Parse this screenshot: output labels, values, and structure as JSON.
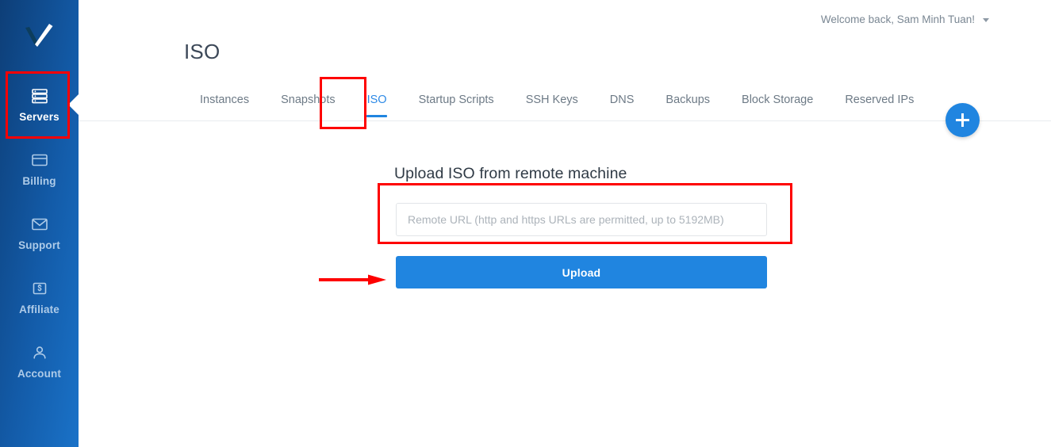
{
  "brand": {
    "name": "Vultr",
    "logo_icon": "vultr-checkmark-logo",
    "accent_color": "#2085e0",
    "sidebar_gradient_from": "#0d3e77",
    "sidebar_gradient_to": "#1a72c8"
  },
  "sidebar": {
    "items": [
      {
        "label": "Servers",
        "icon": "servers-stack-icon",
        "active": true
      },
      {
        "label": "Billing",
        "icon": "credit-card-icon",
        "active": false
      },
      {
        "label": "Support",
        "icon": "envelope-icon",
        "active": false
      },
      {
        "label": "Affiliate",
        "icon": "dollar-box-icon",
        "active": false
      },
      {
        "label": "Account",
        "icon": "user-person-icon",
        "active": false
      }
    ]
  },
  "header": {
    "welcome_text": "Welcome back, Sam Minh Tuan!",
    "caret_icon": "chevron-down-icon"
  },
  "page": {
    "title": "ISO"
  },
  "tabs": [
    {
      "label": "Instances",
      "active": false
    },
    {
      "label": "Snapshots",
      "active": false
    },
    {
      "label": "ISO",
      "active": true
    },
    {
      "label": "Startup Scripts",
      "active": false
    },
    {
      "label": "SSH Keys",
      "active": false
    },
    {
      "label": "DNS",
      "active": false
    },
    {
      "label": "Backups",
      "active": false
    },
    {
      "label": "Block Storage",
      "active": false
    },
    {
      "label": "Reserved IPs",
      "active": false
    }
  ],
  "fab": {
    "icon": "plus-icon",
    "label": "Add"
  },
  "form": {
    "heading": "Upload ISO from remote machine",
    "url_input": {
      "value": "",
      "placeholder": "Remote URL (http and https URLs are permitted, up to 5192MB)"
    },
    "upload_button_label": "Upload"
  },
  "annotations": {
    "color": "#fe0000",
    "boxes": [
      {
        "target": "sidebar-item-servers"
      },
      {
        "target": "tab-iso"
      },
      {
        "target": "remote-url-input"
      }
    ],
    "arrow": {
      "target": "upload-button",
      "direction": "right"
    }
  }
}
